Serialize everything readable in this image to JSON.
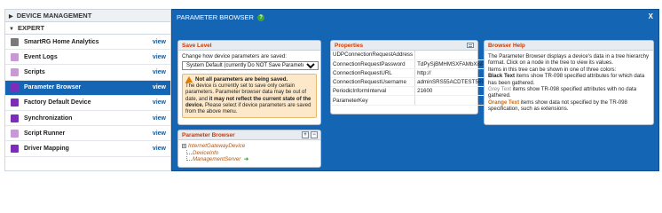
{
  "sidebar": {
    "header": "DEVICE MANAGEMENT",
    "section": "EXPERT",
    "header_caret": "▶",
    "section_caret": "▼",
    "items": [
      {
        "label": "SmartRG Home Analytics",
        "view": "view",
        "color": "#7a7a7a"
      },
      {
        "label": "Event Logs",
        "view": "view",
        "color": "#c79ad6"
      },
      {
        "label": "Scripts",
        "view": "view",
        "color": "#c79ad6"
      },
      {
        "label": "Parameter Browser",
        "view": "view",
        "color": "#7b2fb8",
        "active": true
      },
      {
        "label": "Factory Default Device",
        "view": "view",
        "color": "#7b2fb8"
      },
      {
        "label": "Synchronization",
        "view": "view",
        "color": "#7b2fb8"
      },
      {
        "label": "Script Runner",
        "view": "view",
        "color": "#c79ad6"
      },
      {
        "label": "Driver Mapping",
        "view": "view",
        "color": "#7b2fb8"
      }
    ]
  },
  "main": {
    "title": "PARAMETER BROWSER",
    "help_badge": "?",
    "close": "X"
  },
  "save_level": {
    "title": "Save Level",
    "prompt": "Change how device parameters are saved:",
    "selected": "System Default (currently Do NOT Save Parameters)",
    "warn_title": "Not all parameters are being saved.",
    "warn_text_1": "The device is currently set to save only certain parameters. Parameter browser data may be out of date, and",
    "warn_bold": "it may not reflect the current state of the device.",
    "warn_text_2": "Please select if device parameters are saved from the above menu."
  },
  "properties": {
    "title": "Properties",
    "rows": [
      {
        "key": "UDPConnectionRequestAddress",
        "value": ""
      },
      {
        "key": "ConnectionRequestPassword",
        "value": "TdPySjBMHMSXFAMbXisP"
      },
      {
        "key": "ConnectionRequestURL",
        "value": "http://"
      },
      {
        "key": "ConnectionRequestUsername",
        "value": "adminSRS55ACDTEST569"
      },
      {
        "key": "PeriodicInformInterval",
        "value": "21600"
      },
      {
        "key": "ParameterKey",
        "value": ""
      }
    ]
  },
  "help": {
    "title": "Browser Help",
    "p1": "The Parameter Browser displays a device's data in a tree hierarchy format. Click on a node in the tree to view its values.",
    "p2": "Items in this tree can be shown in one of three colors:",
    "black_label": "Black Text",
    "black_text": " items show TR-098 specified attributes for which data has been gathered.",
    "grey_label": "Grey Text",
    "grey_text": " items show TR-098 specified attributes with no data gathered.",
    "orange_label": "Orange Text",
    "orange_text": " items show data not specified by the TR-098 specification, such as extensions."
  },
  "tree": {
    "title": "Parameter Browser",
    "expand": "+",
    "root": "InternetGatewayDevice",
    "children": [
      "DeviceInfo",
      "ManagementServer"
    ],
    "go_arrow": "➔"
  }
}
